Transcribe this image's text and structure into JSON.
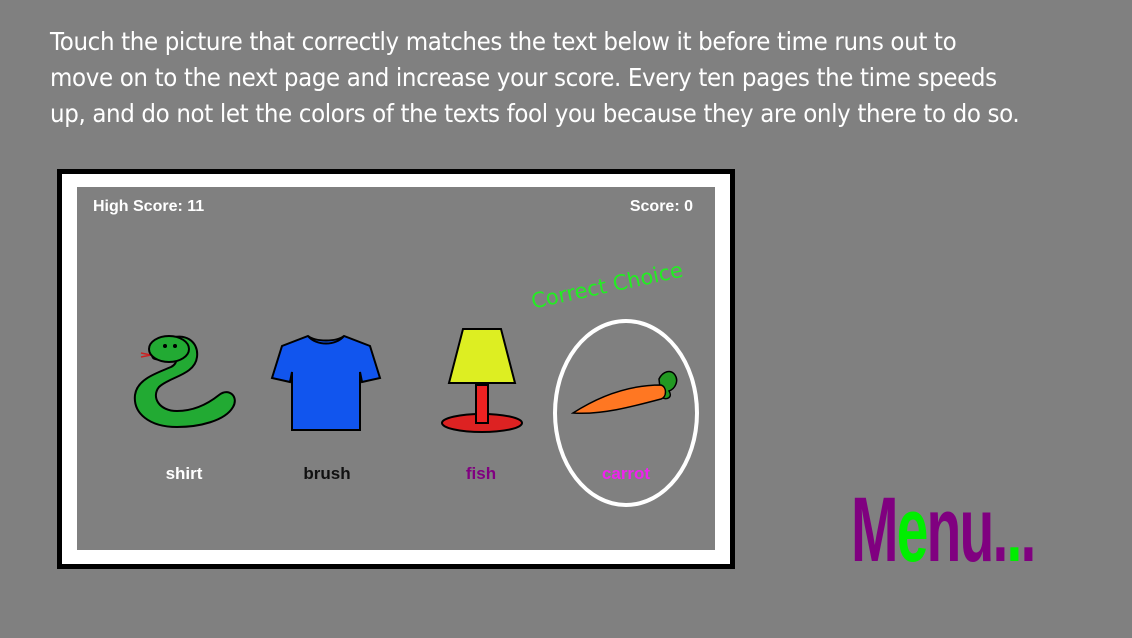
{
  "instructions": "Touch the picture that correctly matches the text below it before time runs out to move on to the next page and increase your score. Every ten pages the time speeds up, and do not let the colors of the texts fool you because they are only there to do so.",
  "game": {
    "high_score_text": "High Score: 11",
    "score_text": "Score: 0",
    "correct_text": "Correct Choice",
    "items": [
      {
        "picture": "snake-icon",
        "label": "shirt",
        "label_color": "#ffffff"
      },
      {
        "picture": "tshirt-icon",
        "label": "brush",
        "label_color": "#111111"
      },
      {
        "picture": "lamp-icon",
        "label": "fish",
        "label_color": "#800080"
      },
      {
        "picture": "carrot-icon",
        "label": "carrot",
        "label_color": "#ee22ee"
      }
    ]
  },
  "menu": {
    "letters": [
      "M",
      "e",
      "n",
      "u",
      ".",
      ".",
      "."
    ],
    "colors": [
      "#800080",
      "#00ee00",
      "#800080",
      "#800080",
      "#800080",
      "#00ee00",
      "#800080"
    ]
  }
}
